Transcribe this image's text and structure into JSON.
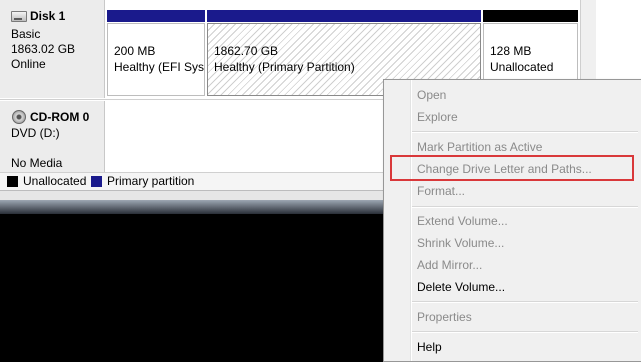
{
  "disk1": {
    "name": "Disk 1",
    "type": "Basic",
    "size": "1863.02 GB",
    "status": "Online",
    "partitions": [
      {
        "size": "200 MB",
        "status": "Healthy (EFI Syst"
      },
      {
        "size": "1862.70 GB",
        "status": "Healthy (Primary Partition)"
      },
      {
        "size": "128 MB",
        "status": "Unallocated"
      }
    ]
  },
  "cdrom": {
    "name": "CD-ROM 0",
    "type": "DVD (D:)",
    "status": "No Media"
  },
  "legend": {
    "unallocated": "Unallocated",
    "primary": "Primary partition"
  },
  "context_menu": {
    "items": [
      {
        "label": "Open",
        "enabled": false
      },
      {
        "label": "Explore",
        "enabled": false
      },
      {
        "label": "Mark Partition as Active",
        "enabled": false
      },
      {
        "label": "Change Drive Letter and Paths...",
        "enabled": false
      },
      {
        "label": "Format...",
        "enabled": false
      },
      {
        "label": "Extend Volume...",
        "enabled": false
      },
      {
        "label": "Shrink Volume...",
        "enabled": false
      },
      {
        "label": "Add Mirror...",
        "enabled": false
      },
      {
        "label": "Delete Volume...",
        "enabled": true
      },
      {
        "label": "Properties",
        "enabled": false
      },
      {
        "label": "Help",
        "enabled": true
      }
    ]
  },
  "colors": {
    "primary_partition": "#1a1a8c",
    "unallocated": "#000000",
    "highlight_box": "#d9383a"
  }
}
